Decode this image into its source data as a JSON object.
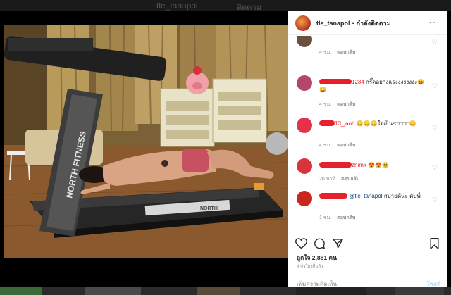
{
  "backdrop": {
    "ghost_username": "tle_tanapol",
    "ghost_follow": "ติดตาม"
  },
  "header": {
    "username": "tle_tanapol",
    "separator": "•",
    "follow_status": "กำลังติดตาม",
    "more_label": "···"
  },
  "photo": {
    "brand_treadmill": "NORTH FITNESS",
    "brand_small": "NORTH",
    "colors": {
      "floor": "#8a5a2e",
      "curtain": "#a68448",
      "treadmill": "#2a2a2a"
    }
  },
  "comments": [
    {
      "user_suffix": "",
      "text": "",
      "time": "4 ชม.",
      "reply": "ตอบกลับ",
      "avatar_color": "#6a5040"
    },
    {
      "user_suffix": "1234",
      "text": "กรี๊ดอย่างแรงงงงงงงง😄😄",
      "time": "4 ชม.",
      "reply": "ตอบกลับ",
      "avatar_color": "#b5466a"
    },
    {
      "user_suffix": "13_jaob",
      "text": "😊😊😊ใจเย็นๆ□□□□😊",
      "time": "4 ชม.",
      "reply": "ตอบกลับ",
      "avatar_color": "#e4324a"
    },
    {
      "user_suffix": "zhimk",
      "text": "😍😍😊",
      "time": "26 นาที",
      "reply": "ตอบกลับ",
      "avatar_color": "#d8343c"
    },
    {
      "user_suffix": "",
      "mention": "@tle_tanapol",
      "text": " สบายดีนะ คับพี่",
      "time": "1 ชม.",
      "reply": "ตอบกลับ",
      "avatar_color": "#c8281e"
    }
  ],
  "actions": {
    "likes": "ถูกใจ 2,881 คน",
    "time_ago": "4 ชั่วโมงที่แล้ว",
    "add_comment_placeholder": "เพิ่มความคิดเห็น",
    "post_label": "โพสต์"
  },
  "icons": [
    "heart-icon",
    "comment-icon",
    "share-icon",
    "bookmark-icon",
    "more-icon"
  ]
}
